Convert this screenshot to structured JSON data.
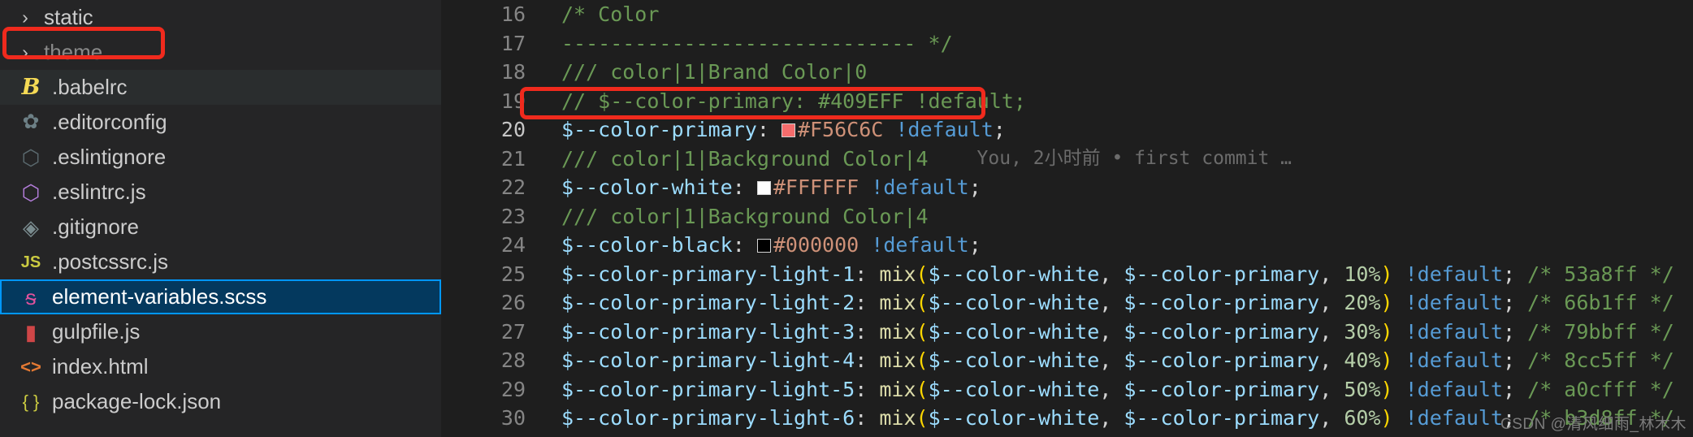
{
  "colors": {
    "editor_bg": "#1e1e1e",
    "sidebar_bg": "#252526",
    "selection_bg": "#04395e",
    "selection_border": "#0097fb",
    "annotation_red": "#f02a1d",
    "comment_green": "#6a9955",
    "variable_blue": "#9cdcfe",
    "keyword_blue": "#569cd6",
    "string_orange": "#ce9178",
    "function_yellow": "#dcdcaa",
    "number_green": "#b5cea8"
  },
  "sidebar": {
    "items": [
      {
        "label": "static",
        "type": "folder",
        "twisty": "chevron-right-icon",
        "icon": "",
        "state": "normal"
      },
      {
        "label": "theme",
        "type": "folder",
        "twisty": "chevron-right-icon",
        "icon": "",
        "state": "annotated"
      },
      {
        "label": ".babelrc",
        "type": "file",
        "twisty": "",
        "icon": "babel-icon",
        "glyph": "B",
        "state": "hovered"
      },
      {
        "label": ".editorconfig",
        "type": "file",
        "twisty": "",
        "icon": "gear-icon",
        "glyph": "✿",
        "state": "normal"
      },
      {
        "label": ".eslintignore",
        "type": "file",
        "twisty": "",
        "icon": "eslint-ignore-icon",
        "glyph": "⬡",
        "state": "normal"
      },
      {
        "label": ".eslintrc.js",
        "type": "file",
        "twisty": "",
        "icon": "eslint-icon",
        "glyph": "⬡",
        "state": "normal"
      },
      {
        "label": ".gitignore",
        "type": "file",
        "twisty": "",
        "icon": "git-icon",
        "glyph": "◈",
        "state": "normal"
      },
      {
        "label": ".postcssrc.js",
        "type": "file",
        "twisty": "",
        "icon": "javascript-icon",
        "glyph": "JS",
        "state": "normal"
      },
      {
        "label": "element-variables.scss",
        "type": "file",
        "twisty": "",
        "icon": "sass-icon",
        "glyph": "ᵴ",
        "state": "selected"
      },
      {
        "label": "gulpfile.js",
        "type": "file",
        "twisty": "",
        "icon": "gulp-icon",
        "glyph": "▮",
        "state": "normal"
      },
      {
        "label": "index.html",
        "type": "file",
        "twisty": "",
        "icon": "html-icon",
        "glyph": "<>",
        "state": "normal"
      },
      {
        "label": "package-lock.json",
        "type": "file",
        "twisty": "",
        "icon": "json-icon",
        "glyph": "{ }",
        "state": "normal"
      }
    ]
  },
  "editor": {
    "blame": {
      "text": "You, 2小时前 • first commit …",
      "on_line": 21
    },
    "lines": [
      {
        "num": 16,
        "tokens": [
          {
            "t": "/* Color",
            "c": "comment"
          }
        ]
      },
      {
        "num": 17,
        "tokens": [
          {
            "t": "----------------------------- */",
            "c": "comment"
          }
        ]
      },
      {
        "num": 18,
        "tokens": [
          {
            "t": "/// color|1|Brand Color|0",
            "c": "comment"
          }
        ]
      },
      {
        "num": 19,
        "tokens": [
          {
            "t": "// $--color-primary: #409EFF !default;",
            "c": "comment"
          }
        ]
      },
      {
        "num": 20,
        "annotated": true,
        "tokens": [
          {
            "t": "$--color-primary",
            "c": "var"
          },
          {
            "t": ":",
            "c": "punct"
          },
          {
            "t": " ",
            "c": "punct"
          },
          {
            "t": "",
            "c": "swatch",
            "color": "#F56C6C"
          },
          {
            "t": "#F56C6C",
            "c": "hex"
          },
          {
            "t": " ",
            "c": "punct"
          },
          {
            "t": "!default",
            "c": "keyword"
          },
          {
            "t": ";",
            "c": "punct"
          }
        ]
      },
      {
        "num": 21,
        "tokens": [
          {
            "t": "/// color|1|Background Color|4",
            "c": "comment"
          }
        ]
      },
      {
        "num": 22,
        "tokens": [
          {
            "t": "$--color-white",
            "c": "var"
          },
          {
            "t": ":",
            "c": "punct"
          },
          {
            "t": " ",
            "c": "punct"
          },
          {
            "t": "",
            "c": "swatch",
            "color": "#FFFFFF"
          },
          {
            "t": "#FFFFFF",
            "c": "hex"
          },
          {
            "t": " ",
            "c": "punct"
          },
          {
            "t": "!default",
            "c": "keyword"
          },
          {
            "t": ";",
            "c": "punct"
          }
        ]
      },
      {
        "num": 23,
        "tokens": [
          {
            "t": "/// color|1|Background Color|4",
            "c": "comment"
          }
        ]
      },
      {
        "num": 24,
        "tokens": [
          {
            "t": "$--color-black",
            "c": "var"
          },
          {
            "t": ":",
            "c": "punct"
          },
          {
            "t": " ",
            "c": "punct"
          },
          {
            "t": "",
            "c": "swatch",
            "color": "#000000"
          },
          {
            "t": "#000000",
            "c": "hex"
          },
          {
            "t": " ",
            "c": "punct"
          },
          {
            "t": "!default",
            "c": "keyword"
          },
          {
            "t": ";",
            "c": "punct"
          }
        ]
      },
      {
        "num": 25,
        "tokens": [
          {
            "t": "$--color-primary-light-1",
            "c": "var"
          },
          {
            "t": ": ",
            "c": "punct"
          },
          {
            "t": "mix",
            "c": "func"
          },
          {
            "t": "(",
            "c": "paren1"
          },
          {
            "t": "$--color-white",
            "c": "var"
          },
          {
            "t": ", ",
            "c": "punct"
          },
          {
            "t": "$--color-primary",
            "c": "var"
          },
          {
            "t": ", ",
            "c": "punct"
          },
          {
            "t": "10%",
            "c": "num"
          },
          {
            "t": ")",
            "c": "paren1"
          },
          {
            "t": " ",
            "c": "punct"
          },
          {
            "t": "!default",
            "c": "keyword"
          },
          {
            "t": "; ",
            "c": "punct"
          },
          {
            "t": "/* 53a8ff */",
            "c": "comment"
          }
        ]
      },
      {
        "num": 26,
        "tokens": [
          {
            "t": "$--color-primary-light-2",
            "c": "var"
          },
          {
            "t": ": ",
            "c": "punct"
          },
          {
            "t": "mix",
            "c": "func"
          },
          {
            "t": "(",
            "c": "paren1"
          },
          {
            "t": "$--color-white",
            "c": "var"
          },
          {
            "t": ", ",
            "c": "punct"
          },
          {
            "t": "$--color-primary",
            "c": "var"
          },
          {
            "t": ", ",
            "c": "punct"
          },
          {
            "t": "20%",
            "c": "num"
          },
          {
            "t": ")",
            "c": "paren1"
          },
          {
            "t": " ",
            "c": "punct"
          },
          {
            "t": "!default",
            "c": "keyword"
          },
          {
            "t": "; ",
            "c": "punct"
          },
          {
            "t": "/* 66b1ff */",
            "c": "comment"
          }
        ]
      },
      {
        "num": 27,
        "tokens": [
          {
            "t": "$--color-primary-light-3",
            "c": "var"
          },
          {
            "t": ": ",
            "c": "punct"
          },
          {
            "t": "mix",
            "c": "func"
          },
          {
            "t": "(",
            "c": "paren1"
          },
          {
            "t": "$--color-white",
            "c": "var"
          },
          {
            "t": ", ",
            "c": "punct"
          },
          {
            "t": "$--color-primary",
            "c": "var"
          },
          {
            "t": ", ",
            "c": "punct"
          },
          {
            "t": "30%",
            "c": "num"
          },
          {
            "t": ")",
            "c": "paren1"
          },
          {
            "t": " ",
            "c": "punct"
          },
          {
            "t": "!default",
            "c": "keyword"
          },
          {
            "t": "; ",
            "c": "punct"
          },
          {
            "t": "/* 79bbff */",
            "c": "comment"
          }
        ]
      },
      {
        "num": 28,
        "tokens": [
          {
            "t": "$--color-primary-light-4",
            "c": "var"
          },
          {
            "t": ": ",
            "c": "punct"
          },
          {
            "t": "mix",
            "c": "func"
          },
          {
            "t": "(",
            "c": "paren1"
          },
          {
            "t": "$--color-white",
            "c": "var"
          },
          {
            "t": ", ",
            "c": "punct"
          },
          {
            "t": "$--color-primary",
            "c": "var"
          },
          {
            "t": ", ",
            "c": "punct"
          },
          {
            "t": "40%",
            "c": "num"
          },
          {
            "t": ")",
            "c": "paren1"
          },
          {
            "t": " ",
            "c": "punct"
          },
          {
            "t": "!default",
            "c": "keyword"
          },
          {
            "t": "; ",
            "c": "punct"
          },
          {
            "t": "/* 8cc5ff */",
            "c": "comment"
          }
        ]
      },
      {
        "num": 29,
        "tokens": [
          {
            "t": "$--color-primary-light-5",
            "c": "var"
          },
          {
            "t": ": ",
            "c": "punct"
          },
          {
            "t": "mix",
            "c": "func"
          },
          {
            "t": "(",
            "c": "paren1"
          },
          {
            "t": "$--color-white",
            "c": "var"
          },
          {
            "t": ", ",
            "c": "punct"
          },
          {
            "t": "$--color-primary",
            "c": "var"
          },
          {
            "t": ", ",
            "c": "punct"
          },
          {
            "t": "50%",
            "c": "num"
          },
          {
            "t": ")",
            "c": "paren1"
          },
          {
            "t": " ",
            "c": "punct"
          },
          {
            "t": "!default",
            "c": "keyword"
          },
          {
            "t": "; ",
            "c": "punct"
          },
          {
            "t": "/* a0cfff */",
            "c": "comment"
          }
        ]
      },
      {
        "num": 30,
        "tokens": [
          {
            "t": "$--color-primary-light-6",
            "c": "var"
          },
          {
            "t": ": ",
            "c": "punct"
          },
          {
            "t": "mix",
            "c": "func"
          },
          {
            "t": "(",
            "c": "paren1"
          },
          {
            "t": "$--color-white",
            "c": "var"
          },
          {
            "t": ", ",
            "c": "punct"
          },
          {
            "t": "$--color-primary",
            "c": "var"
          },
          {
            "t": ", ",
            "c": "punct"
          },
          {
            "t": "60%",
            "c": "num"
          },
          {
            "t": ")",
            "c": "paren1"
          },
          {
            "t": " ",
            "c": "punct"
          },
          {
            "t": "!default",
            "c": "keyword"
          },
          {
            "t": "; ",
            "c": "punct"
          },
          {
            "t": "/* b3d8ff */",
            "c": "comment"
          }
        ]
      }
    ]
  },
  "watermark": {
    "text": "CSDN @清风细雨_林木木"
  }
}
